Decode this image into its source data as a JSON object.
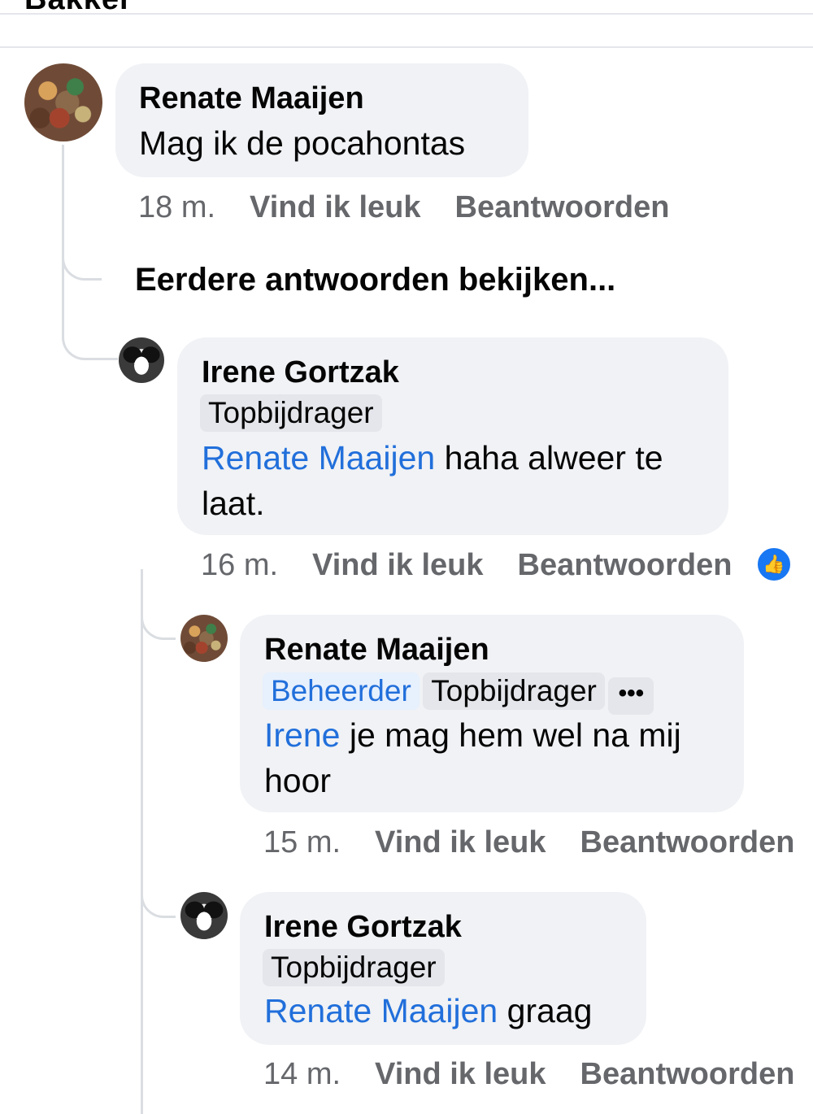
{
  "top_cut_text": "Bakker",
  "comment": {
    "author": "Renate Maaijen",
    "text": "Mag ik de pocahontas",
    "time": "18 m.",
    "like_label": "Vind ik leuk",
    "reply_label": "Beantwoorden"
  },
  "view_more_replies": "Eerdere antwoorden bekijken...",
  "replies": [
    {
      "author": "Irene Gortzak",
      "badges": [
        "Topbijdrager"
      ],
      "mention": "Renate Maaijen",
      "text": " haha alweer te laat.",
      "time": "16 m.",
      "like_label": "Vind ik leuk",
      "reply_label": "Beantwoorden",
      "reaction_icon": "thumbs-up-icon"
    },
    {
      "author": "Renate Maaijen",
      "badges": [
        "Beheerder",
        "Topbijdrager"
      ],
      "more_label": "•••",
      "mention": "Irene",
      "text": " je mag hem wel na mij hoor",
      "time": "15 m.",
      "like_label": "Vind ik leuk",
      "reply_label": "Beantwoorden"
    },
    {
      "author": "Irene Gortzak",
      "badges": [
        "Topbijdrager"
      ],
      "mention": "Renate Maaijen",
      "text": " graag",
      "time": "14 m.",
      "like_label": "Vind ik leuk",
      "reply_label": "Beantwoorden"
    }
  ],
  "colors": {
    "bubble": "#f0f2f5",
    "mention": "#216fdb",
    "meta": "#65676b",
    "badge": "#e4e6eb",
    "admin_badge": "#e7f0fd",
    "like_icon": "#1877f2"
  }
}
